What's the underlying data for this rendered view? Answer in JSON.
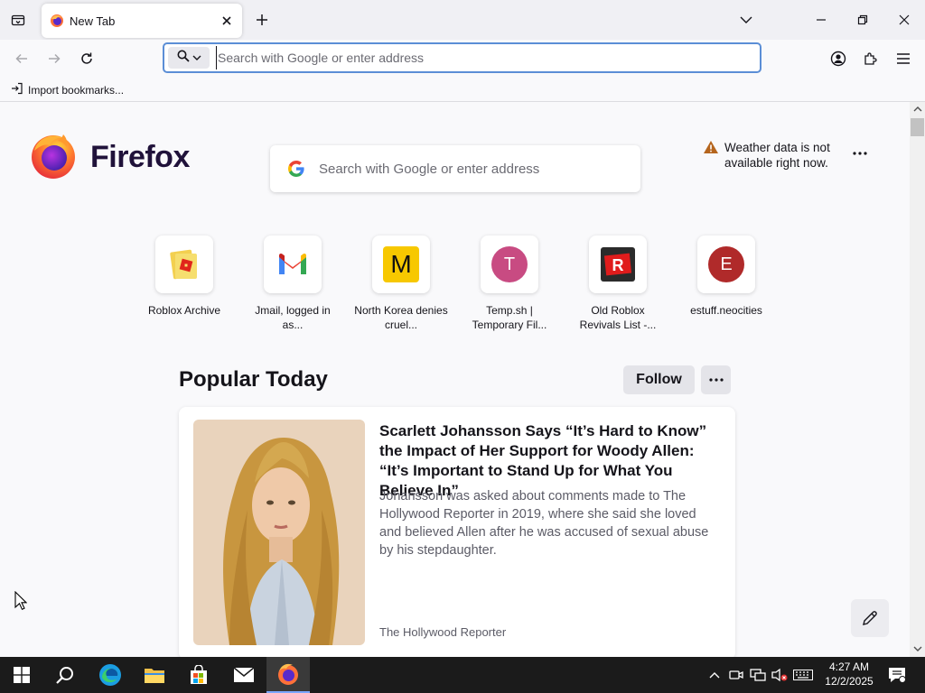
{
  "tab": {
    "title": "New Tab"
  },
  "urlbar": {
    "placeholder": "Search with Google or enter address"
  },
  "bookmarks": {
    "import_label": "Import bookmarks..."
  },
  "logo": {
    "wordmark": "Firefox"
  },
  "search": {
    "placeholder": "Search with Google or enter address"
  },
  "weather": {
    "message": "Weather data is not available right now."
  },
  "top_sites": [
    {
      "label": "Roblox Archive",
      "icon": "roblox-archive-icon"
    },
    {
      "label": "Jmail, logged in as...",
      "icon": "gmail-icon"
    },
    {
      "label": "North Korea denies cruel...",
      "icon": "m-logo-icon",
      "letter": "M"
    },
    {
      "label": "Temp.sh | Temporary Fil...",
      "icon": "letter-t-icon",
      "letter": "T",
      "color": "#c84b82"
    },
    {
      "label": "Old Roblox Revivals List -...",
      "icon": "roblox-logo-icon"
    },
    {
      "label": "estuff.neocities",
      "icon": "letter-e-icon",
      "letter": "E",
      "color": "#b02a2a"
    }
  ],
  "popular": {
    "title": "Popular Today",
    "follow_label": "Follow"
  },
  "story": {
    "title": "Scarlett Johansson Says “It’s Hard to Know” the Impact of Her Support for Woody Allen: “It’s Important to Stand Up for What You Believe In”",
    "description": "Johansson was asked about comments made to The Hollywood Reporter in 2019, where she said she loved and believed Allen after he was accused of sexual abuse by his stepdaughter.",
    "source": "The Hollywood Reporter"
  },
  "clock": {
    "time": "4:27 AM",
    "date": "12/2/2025"
  },
  "colors": {
    "accent": "#5b8ed6",
    "firefox_wordmark": "#20123a",
    "taskbar": "#1b1b1b"
  }
}
